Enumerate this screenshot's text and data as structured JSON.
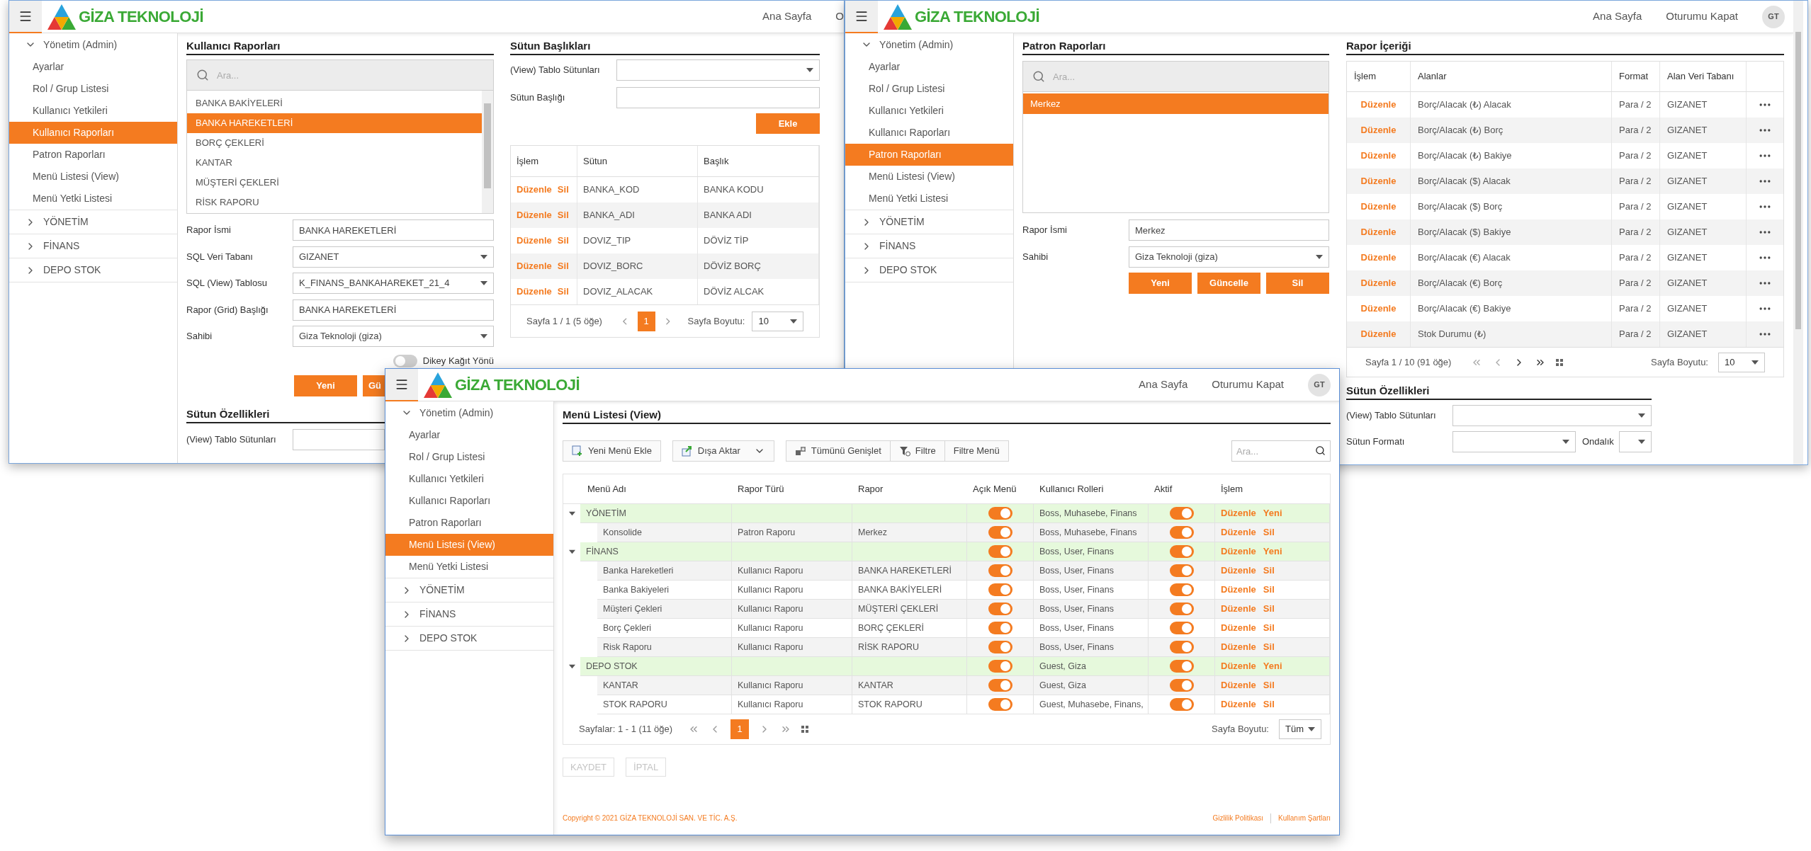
{
  "left_window": {
    "header": {
      "logo": "GİZA TEKNOLOJİ",
      "nav": [
        "Ana Sayfa",
        "O"
      ]
    },
    "sidebar": [
      {
        "label": "Yönetim (Admin)",
        "expanded": true,
        "children": [
          {
            "label": "Ayarlar",
            "selected": false
          },
          {
            "label": "Rol / Grup Listesi",
            "selected": false
          },
          {
            "label": "Kullanıcı Yetkileri",
            "selected": false
          },
          {
            "label": "Kullanıcı Raporları",
            "selected": true
          },
          {
            "label": "Patron Raporları",
            "selected": false
          },
          {
            "label": "Menü Listesi (View)",
            "selected": false
          },
          {
            "label": "Menü Yetki Listesi",
            "selected": false
          }
        ]
      },
      {
        "label": "YÖNETİM",
        "expanded": false
      },
      {
        "label": "FİNANS",
        "expanded": false
      },
      {
        "label": "DEPO STOK",
        "expanded": false
      }
    ],
    "reports_panel": {
      "title": "Kullanıcı Raporları",
      "search_placeholder": "Ara...",
      "items": [
        {
          "label": "BANKA BAKİYELERİ",
          "selected": false
        },
        {
          "label": "BANKA HAREKETLERİ",
          "selected": true
        },
        {
          "label": "BORÇ ÇEKLERİ",
          "selected": false
        },
        {
          "label": "KANTAR",
          "selected": false
        },
        {
          "label": "MÜŞTERİ ÇEKLERİ",
          "selected": false
        },
        {
          "label": "RİSK RAPORU",
          "selected": false
        }
      ],
      "fields": [
        {
          "label": "Rapor İsmi",
          "kind": "input",
          "value": "BANKA HAREKETLERİ"
        },
        {
          "label": "SQL Veri Tabanı",
          "kind": "select",
          "value": "GIZANET"
        },
        {
          "label": "SQL (View) Tablosu",
          "kind": "select",
          "value": "K_FINANS_BANKAHAREKET_21_4"
        },
        {
          "label": "Rapor (Grid) Başlığı",
          "kind": "input",
          "value": "BANKA HAREKETLERİ"
        },
        {
          "label": "Sahibi",
          "kind": "select",
          "value": "Giza Teknoloji (giza)"
        }
      ],
      "toggle": {
        "label": "Dikey Kağıt Yönü",
        "on": false
      },
      "buttons": [
        "Yeni",
        "Gü"
      ]
    },
    "column_properties": {
      "title": "Sütun Özellikleri",
      "fields": [
        {
          "label": "(View) Tablo Sütunları",
          "kind": "input"
        }
      ]
    },
    "columns_panel": {
      "title": "Sütun Başlıkları",
      "fields": [
        {
          "label": "(View) Tablo Sütunları",
          "kind": "select"
        },
        {
          "label": "Sütun Başlığı",
          "kind": "input"
        }
      ],
      "add_button": "Ekle",
      "table": {
        "columns": [
          "İşlem",
          "Sütun",
          "Başlık"
        ],
        "rows": [
          {
            "actions": [
              "Düzenle",
              "Sil"
            ],
            "column": "BANKA_KOD",
            "title": "BANKA KODU"
          },
          {
            "actions": [
              "Düzenle",
              "Sil"
            ],
            "column": "BANKA_ADI",
            "title": "BANKA ADI"
          },
          {
            "actions": [
              "Düzenle",
              "Sil"
            ],
            "column": "DOVIZ_TIP",
            "title": "DÖVİZ TİP"
          },
          {
            "actions": [
              "Düzenle",
              "Sil"
            ],
            "column": "DOVIZ_BORC",
            "title": "DÖVİZ BORÇ"
          },
          {
            "actions": [
              "Düzenle",
              "Sil"
            ],
            "column": "DOVIZ_ALACAK",
            "title": "DÖVİZ ALCAK"
          }
        ]
      },
      "pager": {
        "summary": "Sayfa 1 / 1 (5 öğe)",
        "pages": [
          {
            "label": "1",
            "selected": true
          }
        ],
        "size_label": "Sayfa Boyutu:",
        "size": "10"
      }
    }
  },
  "right_window": {
    "header": {
      "logo": "GİZA TEKNOLOJİ",
      "nav": [
        "Ana Sayfa",
        "Oturumu Kapat"
      ],
      "avatar": "GT"
    },
    "sidebar": [
      {
        "label": "Yönetim (Admin)",
        "expanded": true,
        "children": [
          {
            "label": "Ayarlar",
            "selected": false
          },
          {
            "label": "Rol / Grup Listesi",
            "selected": false
          },
          {
            "label": "Kullanıcı Yetkileri",
            "selected": false
          },
          {
            "label": "Kullanıcı Raporları",
            "selected": false
          },
          {
            "label": "Patron Raporları",
            "selected": true
          },
          {
            "label": "Menü Listesi (View)",
            "selected": false
          },
          {
            "label": "Menü Yetki Listesi",
            "selected": false
          }
        ]
      },
      {
        "label": "YÖNETİM",
        "expanded": false
      },
      {
        "label": "FİNANS",
        "expanded": false
      },
      {
        "label": "DEPO STOK",
        "expanded": false
      }
    ],
    "reports_panel": {
      "title": "Patron Raporları",
      "search_placeholder": "Ara...",
      "items": [
        {
          "label": "Merkez",
          "selected": true
        }
      ],
      "fields": [
        {
          "label": "Rapor İsmi",
          "kind": "input",
          "value": "Merkez"
        },
        {
          "label": "Sahibi",
          "kind": "select",
          "value": "Giza Teknoloji (giza)"
        }
      ],
      "buttons": [
        "Yeni",
        "Güncelle",
        "Sil"
      ]
    },
    "content_panel": {
      "title": "Rapor İçeriği",
      "table": {
        "columns": [
          "İşlem",
          "Alanlar",
          "Format",
          "Alan Veri Tabanı"
        ],
        "rows": [
          {
            "action": "Düzenle",
            "field": "Borç/Alacak (₺) Alacak",
            "format": "Para / 2",
            "database": "GIZANET"
          },
          {
            "action": "Düzenle",
            "field": "Borç/Alacak (₺) Borç",
            "format": "Para / 2",
            "database": "GIZANET"
          },
          {
            "action": "Düzenle",
            "field": "Borç/Alacak (₺) Bakiye",
            "format": "Para / 2",
            "database": "GIZANET"
          },
          {
            "action": "Düzenle",
            "field": "Borç/Alacak ($) Alacak",
            "format": "Para / 2",
            "database": "GIZANET"
          },
          {
            "action": "Düzenle",
            "field": "Borç/Alacak ($) Borç",
            "format": "Para / 2",
            "database": "GIZANET"
          },
          {
            "action": "Düzenle",
            "field": "Borç/Alacak ($) Bakiye",
            "format": "Para / 2",
            "database": "GIZANET"
          },
          {
            "action": "Düzenle",
            "field": "Borç/Alacak (€) Alacak",
            "format": "Para / 2",
            "database": "GIZANET"
          },
          {
            "action": "Düzenle",
            "field": "Borç/Alacak (€) Borç",
            "format": "Para / 2",
            "database": "GIZANET"
          },
          {
            "action": "Düzenle",
            "field": "Borç/Alacak (€) Bakiye",
            "format": "Para / 2",
            "database": "GIZANET"
          },
          {
            "action": "Düzenle",
            "field": "Stok Durumu (₺)",
            "format": "Para / 2",
            "database": "GIZANET"
          }
        ]
      },
      "pager": {
        "summary": "Sayfa 1 / 10 (91 öğe)",
        "size_label": "Sayfa Boyutu:",
        "size": "10"
      }
    },
    "column_properties": {
      "title": "Sütun Özellikleri",
      "fields": [
        {
          "label": "(View) Tablo Sütunları",
          "kind": "select"
        },
        {
          "label": "Sütun Formatı",
          "kind": "select"
        }
      ],
      "decimal_label": "Ondalık"
    }
  },
  "front_window": {
    "header": {
      "logo": "GİZA TEKNOLOJİ",
      "nav": [
        "Ana Sayfa",
        "Oturumu Kapat"
      ],
      "avatar": "GT"
    },
    "sidebar": [
      {
        "label": "Yönetim (Admin)",
        "expanded": true,
        "children": [
          {
            "label": "Ayarlar",
            "selected": false
          },
          {
            "label": "Rol / Grup Listesi",
            "selected": false
          },
          {
            "label": "Kullanıcı Yetkileri",
            "selected": false
          },
          {
            "label": "Kullanıcı Raporları",
            "selected": false
          },
          {
            "label": "Patron Raporları",
            "selected": false
          },
          {
            "label": "Menü Listesi (View)",
            "selected": true
          },
          {
            "label": "Menü Yetki Listesi",
            "selected": false
          }
        ]
      },
      {
        "label": "YÖNETİM",
        "expanded": false
      },
      {
        "label": "FİNANS",
        "expanded": false
      },
      {
        "label": "DEPO STOK",
        "expanded": false
      }
    ],
    "title": "Menü Listesi (View)",
    "toolbar": [
      {
        "buttons": [
          {
            "label": "Yeni Menü Ekle",
            "kind": "add"
          }
        ]
      },
      {
        "buttons": [
          {
            "label": "Dışa Aktar",
            "kind": "export"
          }
        ]
      },
      {
        "buttons": [
          {
            "label": "Tümünü Genişlet",
            "kind": "expand"
          },
          {
            "label": "Filtre",
            "kind": "filter"
          },
          {
            "label": "Filtre Menü",
            "kind": "plain"
          }
        ]
      }
    ],
    "search_placeholder": "Ara...",
    "grid": {
      "columns": [
        "Menü Adı",
        "Rapor Türü",
        "Rapor",
        "Açık Menü",
        "Kullanıcı Rolleri",
        "Aktif",
        "İşlem"
      ],
      "rows": [
        {
          "name": "YÖNETİM",
          "expanded": true,
          "open_menu": true,
          "roles": "Boss, Muhasebe, Finans",
          "active": true,
          "actions": [
            "Düzenle",
            "Yeni"
          ],
          "children": [
            {
              "name": "Konsolide",
              "report_type": "Patron Raporu",
              "report": "Merkez",
              "open_menu": true,
              "roles": "Boss, Muhasebe, Finans",
              "active": true,
              "actions": [
                "Düzenle",
                "Sil"
              ]
            }
          ]
        },
        {
          "name": "FİNANS",
          "expanded": true,
          "open_menu": true,
          "roles": "Boss, User, Finans",
          "active": true,
          "actions": [
            "Düzenle",
            "Yeni"
          ],
          "children": [
            {
              "name": "Banka Hareketleri",
              "report_type": "Kullanıcı Raporu",
              "report": "BANKA HAREKETLERİ",
              "open_menu": true,
              "roles": "Boss, User, Finans",
              "active": true,
              "actions": [
                "Düzenle",
                "Sil"
              ]
            },
            {
              "name": "Banka Bakiyeleri",
              "report_type": "Kullanıcı Raporu",
              "report": "BANKA BAKİYELERİ",
              "open_menu": true,
              "roles": "Boss, User, Finans",
              "active": true,
              "actions": [
                "Düzenle",
                "Sil"
              ]
            },
            {
              "name": "Müşteri Çekleri",
              "report_type": "Kullanıcı Raporu",
              "report": "MÜŞTERİ ÇEKLERİ",
              "open_menu": true,
              "roles": "Boss, User, Finans",
              "active": true,
              "actions": [
                "Düzenle",
                "Sil"
              ]
            },
            {
              "name": "Borç Çekleri",
              "report_type": "Kullanıcı Raporu",
              "report": "BORÇ ÇEKLERİ",
              "open_menu": true,
              "roles": "Boss, User, Finans",
              "active": true,
              "actions": [
                "Düzenle",
                "Sil"
              ]
            },
            {
              "name": "Risk Raporu",
              "report_type": "Kullanıcı Raporu",
              "report": "RİSK RAPORU",
              "open_menu": true,
              "roles": "Boss, User, Finans",
              "active": true,
              "actions": [
                "Düzenle",
                "Sil"
              ]
            }
          ]
        },
        {
          "name": "DEPO STOK",
          "expanded": true,
          "open_menu": true,
          "roles": "Guest, Giza",
          "active": true,
          "actions": [
            "Düzenle",
            "Yeni"
          ],
          "children": [
            {
              "name": "KANTAR",
              "report_type": "Kullanıcı Raporu",
              "report": "KANTAR",
              "open_menu": true,
              "roles": "Guest, Giza",
              "active": true,
              "actions": [
                "Düzenle",
                "Sil"
              ]
            },
            {
              "name": "STOK RAPORU",
              "report_type": "Kullanıcı Raporu",
              "report": "STOK RAPORU",
              "open_menu": true,
              "roles": "Guest, Muhasebe, Finans,",
              "active": true,
              "actions": [
                "Düzenle",
                "Sil"
              ]
            }
          ]
        }
      ]
    },
    "pager": {
      "summary": "Sayfalar: 1 - 1 (11 öğe)",
      "pages": [
        {
          "label": "1",
          "selected": true
        }
      ],
      "size_label": "Sayfa Boyutu:",
      "size": "Tüm"
    },
    "actions": [
      {
        "label": "KAYDET",
        "disabled": true
      },
      {
        "label": "İPTAL",
        "disabled": true
      }
    ],
    "footer": {
      "copyright": "Copyright © 2021 GİZA TEKNOLOJİ SAN. VE TİC. A.Ş.",
      "links": [
        "Gizlilik Politikası",
        "Kullanım Şartları"
      ]
    }
  }
}
